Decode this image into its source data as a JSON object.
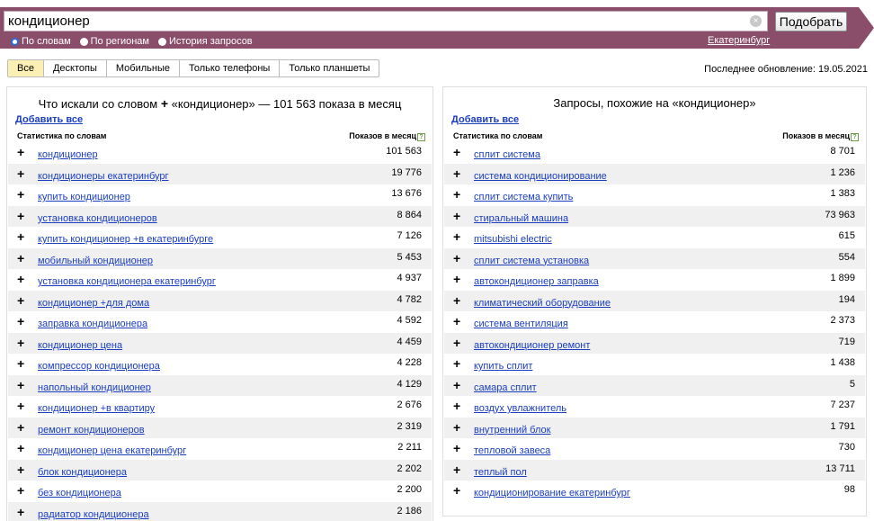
{
  "search": {
    "query": "кондиционер",
    "button": "Подобрать",
    "clear_glyph": "×",
    "modes": [
      {
        "label": "По словам",
        "selected": true
      },
      {
        "label": "По регионам",
        "selected": false
      },
      {
        "label": "История запросов",
        "selected": false
      }
    ],
    "region": "Екатеринбург"
  },
  "devices": {
    "tabs": [
      "Все",
      "Десктопы",
      "Мобильные",
      "Только телефоны",
      "Только планшеты"
    ],
    "active": 0,
    "updated": "Последнее обновление: 19.05.2021"
  },
  "left": {
    "title_prefix": "Что искали со словом",
    "plus_glyph": "+",
    "title_suffix": "«кондиционер» — 101 563 показа в месяц",
    "add_all": "Добавить все",
    "col_words": "Статистика по словам",
    "col_count": "Показов в месяц",
    "help_glyph": "?",
    "rows": [
      {
        "kw": "кондиционер",
        "count": "101 563"
      },
      {
        "kw": "кондиционеры екатеринбург",
        "count": "19 776"
      },
      {
        "kw": "купить кондиционер",
        "count": "13 676"
      },
      {
        "kw": "установка кондиционеров",
        "count": "8 864"
      },
      {
        "kw": "купить кондиционер +в екатеринбурге",
        "count": "7 126"
      },
      {
        "kw": "мобильный кондиционер",
        "count": "5 453"
      },
      {
        "kw": "установка кондиционера екатеринбург",
        "count": "4 937"
      },
      {
        "kw": "кондиционер +для дома",
        "count": "4 782"
      },
      {
        "kw": "заправка кондиционера",
        "count": "4 592"
      },
      {
        "kw": "кондиционер цена",
        "count": "4 459"
      },
      {
        "kw": "компрессор кондиционера",
        "count": "4 228"
      },
      {
        "kw": "напольный кондиционер",
        "count": "4 129"
      },
      {
        "kw": "кондиционер +в квартиру",
        "count": "2 676"
      },
      {
        "kw": "ремонт кондиционеров",
        "count": "2 319"
      },
      {
        "kw": "кондиционер цена екатеринбург",
        "count": "2 211"
      },
      {
        "kw": "блок кондиционера",
        "count": "2 202"
      },
      {
        "kw": "без кондиционера",
        "count": "2 200"
      },
      {
        "kw": "радиатор кондиционера",
        "count": "2 186"
      }
    ]
  },
  "right": {
    "title": "Запросы, похожие на «кондиционер»",
    "add_all": "Добавить все",
    "col_words": "Статистика по словам",
    "col_count": "Показов в месяц",
    "help_glyph": "?",
    "rows": [
      {
        "kw": "сплит система",
        "count": "8 701"
      },
      {
        "kw": "система кондиционирование",
        "count": "1 236"
      },
      {
        "kw": "сплит система купить",
        "count": "1 383"
      },
      {
        "kw": "стиральный машина",
        "count": "73 963"
      },
      {
        "kw": "mitsubishi electric",
        "count": "615"
      },
      {
        "kw": "сплит система установка",
        "count": "554"
      },
      {
        "kw": "автокондиционер заправка",
        "count": "1 899"
      },
      {
        "kw": "климатический оборудование",
        "count": "194"
      },
      {
        "kw": "система вентиляция",
        "count": "2 373"
      },
      {
        "kw": "автокондиционер ремонт",
        "count": "719"
      },
      {
        "kw": "купить сплит",
        "count": "1 438"
      },
      {
        "kw": "самара сплит",
        "count": "5"
      },
      {
        "kw": "воздух увлажнитель",
        "count": "7 237"
      },
      {
        "kw": "внутренний блок",
        "count": "1 791"
      },
      {
        "kw": "тепловой завеса",
        "count": "730"
      },
      {
        "kw": "теплый пол",
        "count": "13 711"
      },
      {
        "kw": "кондиционирование екатеринбург",
        "count": "98"
      }
    ]
  }
}
